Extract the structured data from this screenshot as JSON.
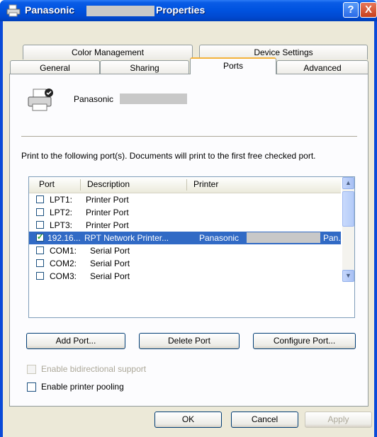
{
  "window": {
    "title_prefix": "Panasonic",
    "title_suffix": "Properties",
    "help_label": "?",
    "close_label": "X"
  },
  "tabs": {
    "row1": [
      "Color Management",
      "Device Settings"
    ],
    "row2": [
      "General",
      "Sharing",
      "Ports",
      "Advanced"
    ],
    "active": "Ports"
  },
  "printer": {
    "name": "Panasonic"
  },
  "description": "Print to the following port(s). Documents will print to the first free checked port.",
  "ports_table": {
    "headers": [
      "Port",
      "Description",
      "Printer"
    ],
    "rows": [
      {
        "port": "LPT1:",
        "description": "Printer Port",
        "printer": "",
        "printer_suffix": "",
        "checked": false,
        "selected": false
      },
      {
        "port": "LPT2:",
        "description": "Printer Port",
        "printer": "",
        "printer_suffix": "",
        "checked": false,
        "selected": false
      },
      {
        "port": "LPT3:",
        "description": "Printer Port",
        "printer": "",
        "printer_suffix": "",
        "checked": false,
        "selected": false
      },
      {
        "port": "192.16...",
        "description": "RPT Network Printer...",
        "printer": "Panasonic",
        "printer_suffix": "Pan...",
        "checked": true,
        "selected": true
      },
      {
        "port": "COM1:",
        "description": "Serial Port",
        "printer": "",
        "printer_suffix": "",
        "checked": false,
        "selected": false
      },
      {
        "port": "COM2:",
        "description": "Serial Port",
        "printer": "",
        "printer_suffix": "",
        "checked": false,
        "selected": false
      },
      {
        "port": "COM3:",
        "description": "Serial Port",
        "printer": "",
        "printer_suffix": "",
        "checked": false,
        "selected": false
      }
    ]
  },
  "port_buttons": {
    "add": "Add Port...",
    "delete": "Delete Port",
    "configure": "Configure Port..."
  },
  "options": {
    "bidirectional": {
      "label": "Enable bidirectional support",
      "checked": false,
      "enabled": false
    },
    "pooling": {
      "label": "Enable printer pooling",
      "checked": false,
      "enabled": true
    }
  },
  "dialog_buttons": {
    "ok": "OK",
    "cancel": "Cancel",
    "apply": "Apply"
  },
  "colors": {
    "titlebar": "#0053e0",
    "selection": "#316ac5",
    "dialog_bg": "#ece9d8",
    "active_tab_accent": "#f4b23a"
  }
}
